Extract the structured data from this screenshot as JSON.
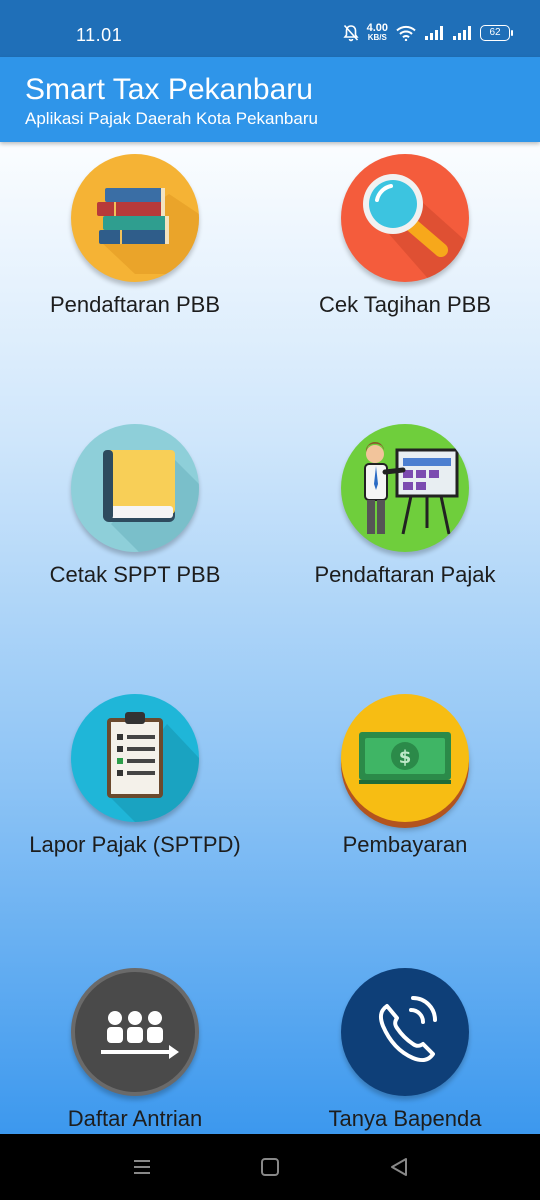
{
  "status_bar": {
    "time": "11.01",
    "net_speed_value": "4.00",
    "net_speed_unit": "KB/S",
    "battery": "62"
  },
  "app_bar": {
    "title": "Smart Tax Pekanbaru",
    "subtitle": "Aplikasi Pajak Daerah Kota Pekanbaru"
  },
  "menu": [
    {
      "label": "Pendaftaran PBB",
      "icon": "books-icon",
      "color": "#f5b335"
    },
    {
      "label": "Cek Tagihan PBB",
      "icon": "magnifier-icon",
      "color": "#f45c3c"
    },
    {
      "label": "Cetak SPPT PBB",
      "icon": "book-icon",
      "color": "#8ecfd9"
    },
    {
      "label": "Pendaftaran Pajak",
      "icon": "presentation-icon",
      "color": "#6fce3c"
    },
    {
      "label": "Lapor Pajak (SPTPD)",
      "icon": "clipboard-icon",
      "color": "#1fb6d8"
    },
    {
      "label": "Pembayaran",
      "icon": "money-icon",
      "color": "#f7bd13"
    },
    {
      "label": "Daftar Antrian",
      "icon": "queue-icon",
      "color": "#4a4a4a"
    },
    {
      "label": "Tanya Bapenda",
      "icon": "phone-icon",
      "color": "#0e3f78"
    }
  ]
}
